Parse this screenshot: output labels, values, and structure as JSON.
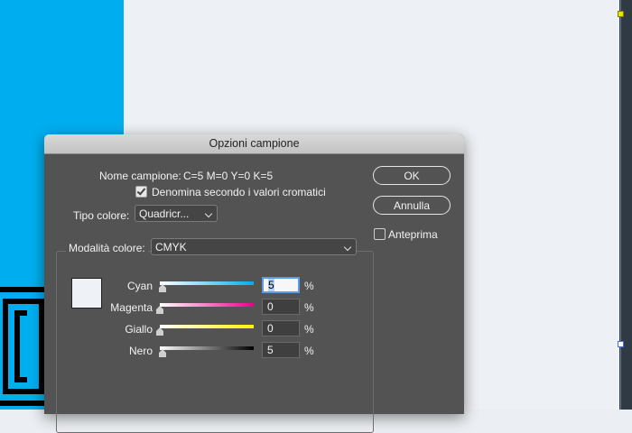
{
  "dialog": {
    "title": "Opzioni campione",
    "swatch_name_label": "Nome campione:",
    "swatch_name_value": "C=5 M=0 Y=0 K=5",
    "name_by_value_label": "Denomina secondo i valori cromatici",
    "name_by_value_checked": true,
    "color_type_label": "Tipo colore:",
    "color_type_value": "Quadricr...",
    "color_mode_label": "Modalità colore:",
    "color_mode_value": "CMYK",
    "ok_label": "OK",
    "cancel_label": "Annulla",
    "preview_label": "Anteprima",
    "preview_checked": false,
    "percent_symbol": "%",
    "sliders": [
      {
        "label": "Cyan",
        "value": "5",
        "color": "#00aeef"
      },
      {
        "label": "Magenta",
        "value": "0",
        "color": "#ec008c"
      },
      {
        "label": "Giallo",
        "value": "0",
        "color": "#fff200"
      },
      {
        "label": "Nero",
        "value": "5",
        "color": "#000000"
      }
    ]
  },
  "colors": {
    "canvas_blue": "#00aeef",
    "dialog_bg": "#535353",
    "swatch_preview": "#eef1f5"
  }
}
